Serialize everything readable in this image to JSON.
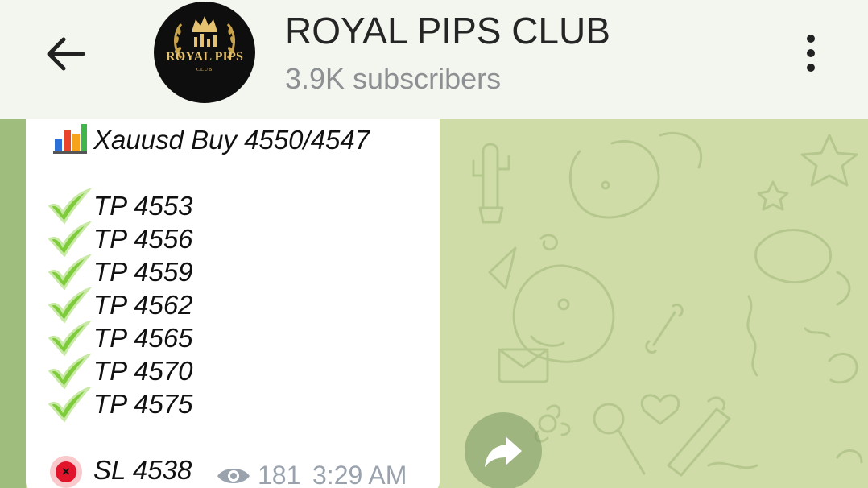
{
  "header": {
    "channel_name": "ROYAL PIPS CLUB",
    "subscribers": "3.9K subscribers",
    "avatar_logo_text": "ROYAL PIPS",
    "avatar_logo_sub": "CLUB",
    "back_icon": "arrow-left-icon",
    "menu_icon": "more-vert-icon"
  },
  "message": {
    "signal": "Xauusd Buy  4550/4547",
    "signal_icon": "bar-chart-emoji",
    "targets": [
      "TP 4553",
      "TP 4556",
      "TP 4559",
      "TP 4562",
      "TP 4565",
      "TP 4570",
      "TP 4575"
    ],
    "target_icon": "check-mark-emoji",
    "stop_loss": "SL 4538",
    "stop_loss_icon": "cross-mark-emoji",
    "views": "181",
    "views_icon": "eye-icon",
    "time": "3:29 AM"
  },
  "actions": {
    "forward_icon": "forward-arrow-icon"
  },
  "colors": {
    "header_bg": "#f3f6ef",
    "chat_bg": "#cfdca8",
    "bubble_bg": "#ffffff",
    "meta_text": "#9aa3ad",
    "check_green": "#7ecb3c",
    "cross_red": "#e0142b"
  }
}
